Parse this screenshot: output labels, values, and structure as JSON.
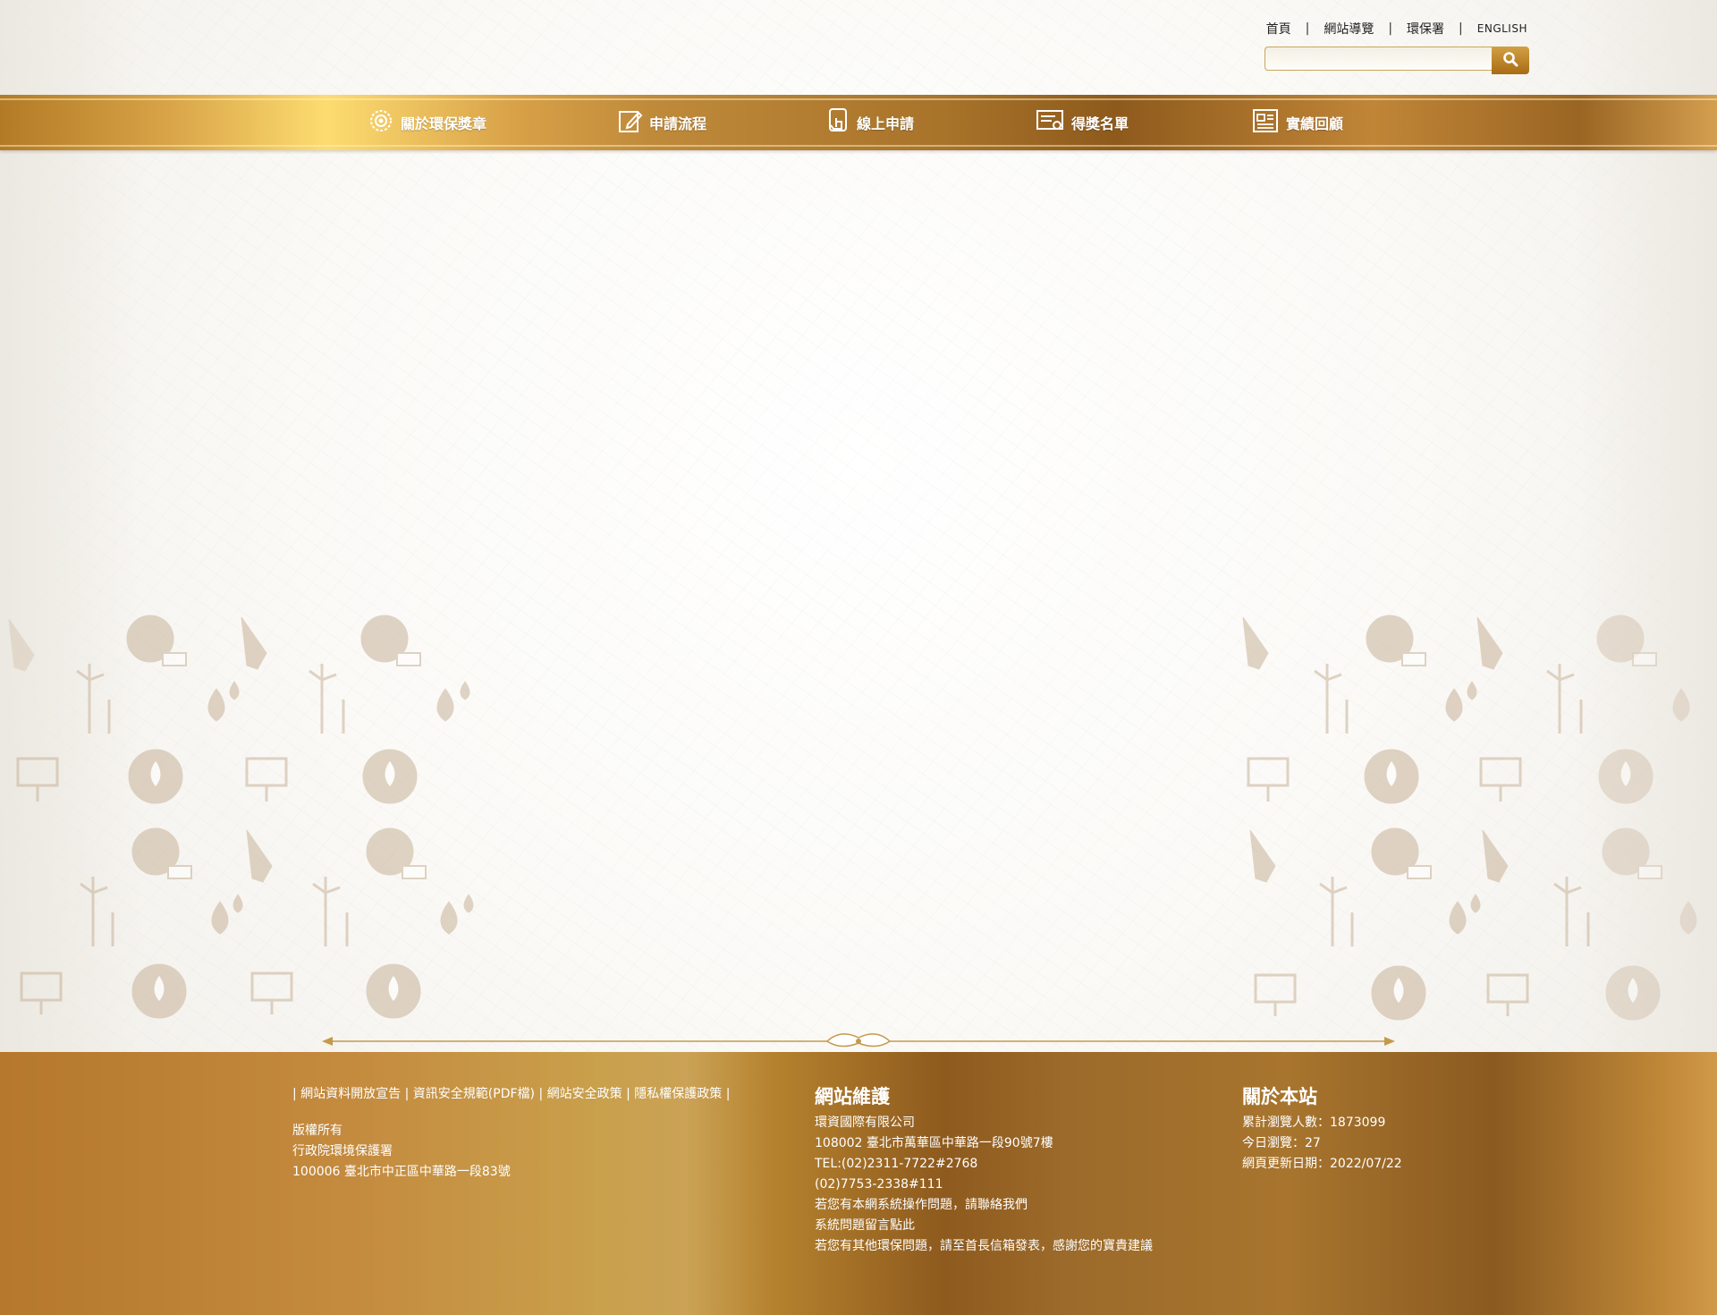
{
  "top_links": {
    "home": "首頁",
    "sitemap": "網站導覽",
    "epa": "環保署",
    "english": "ENGLISH",
    "separator": "|"
  },
  "search": {
    "placeholder": "",
    "button_icon": "search-icon"
  },
  "nav": {
    "items": [
      {
        "label": "關於環保獎章",
        "icon": "medal-icon"
      },
      {
        "label": "申請流程",
        "icon": "edit-form-icon"
      },
      {
        "label": "線上申請",
        "icon": "touch-apply-icon"
      },
      {
        "label": "得獎名單",
        "icon": "certificate-icon"
      },
      {
        "label": "實績回顧",
        "icon": "newspaper-icon"
      }
    ]
  },
  "colors": {
    "gold_light": "#fddc70",
    "gold_mid": "#c9a04c",
    "gold_dark": "#8e5a1c",
    "icon_tan": "#c8b39a"
  },
  "footer": {
    "links": {
      "pipe": "|",
      "open_data": "網站資料開放宣告",
      "security_rules": "資訊安全規範(PDF檔)",
      "security_policy": "網站安全政策",
      "privacy": "隱私權保護政策"
    },
    "copyright": {
      "title": "版權所有",
      "org": "行政院環境保護署",
      "address": "100006 臺北市中正區中華路一段83號"
    },
    "maintenance": {
      "heading": "網站維護",
      "company": "環資國際有限公司",
      "address": "108002 臺北市萬華區中華路一段90號7樓",
      "tel": "TEL:(02)2311-7722#2768",
      "tel2": "(02)7753-2338#111",
      "contact_note": "若您有本網系統操作問題，請聯絡我們",
      "message_note": "系統問題留言點此",
      "mailbox_note": "若您有其他環保問題，請至首長信箱發表，感謝您的寶貴建議"
    },
    "about": {
      "heading": "關於本站",
      "total_visits": "累計瀏覽人數：1873099",
      "today_visits": "今日瀏覽：27",
      "updated": "網頁更新日期：2022/07/22"
    }
  }
}
